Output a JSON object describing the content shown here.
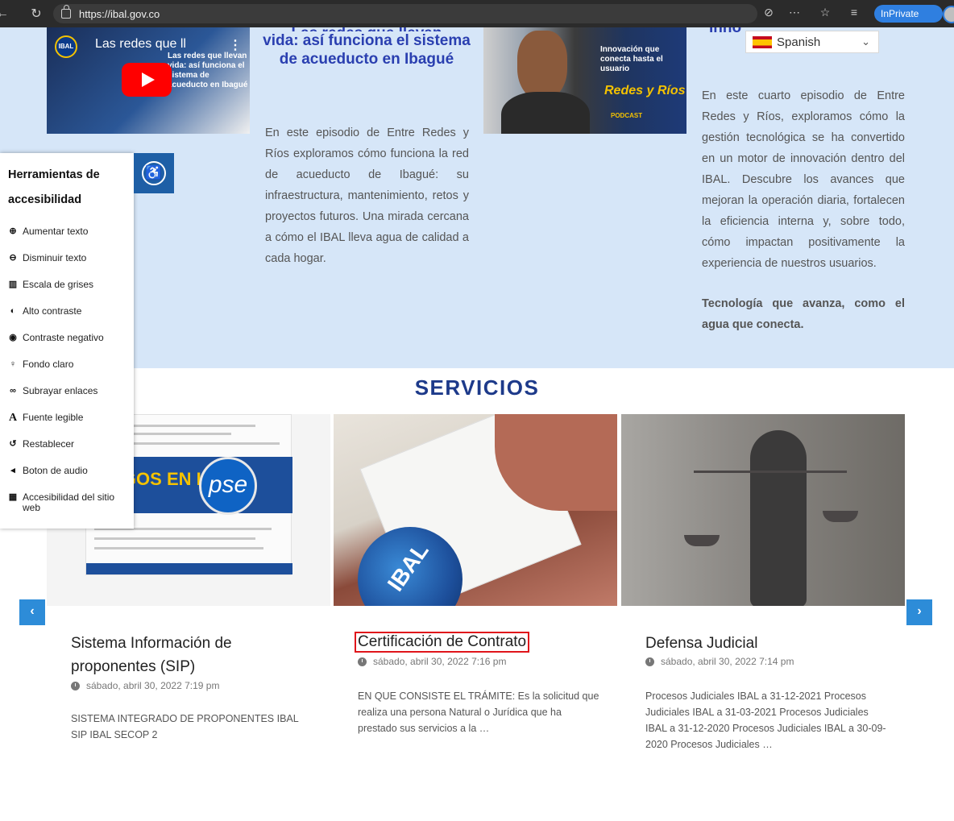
{
  "browser": {
    "url": "https://ibal.gov.co",
    "inprivate_label": "InPrivate",
    "icons": [
      "back-icon",
      "refresh-icon",
      "lock-icon",
      "tracking-icon",
      "more-icon",
      "favorites-icon",
      "collections-icon",
      "profile-icon"
    ]
  },
  "language": {
    "selected": "Spanish"
  },
  "episodes": {
    "video": {
      "title": "Las redes que ll",
      "thumb_caption": "Las redes que llevan vida: así funciona el sistema de acueducto en Ibagué"
    },
    "episode2": {
      "title_cut": "Las redes que llevan",
      "title": "vida: así funciona el sistema de acueducto en Ibagué",
      "body": "En este episodio de Entre Redes y Ríos exploramos cómo funciona la red de acueducto de Ibagué: su infraestructura, mantenimiento, retos y proyectos futuros. Una mirada cercana a cómo el IBAL lleva agua de calidad a cada hogar."
    },
    "episode3_thumb": {
      "caption": "Innovación que conecta hasta el usuario",
      "brand": "Redes y Ríos",
      "sub": "PODCAST"
    },
    "episode4": {
      "title": "Inno",
      "body": "En este cuarto episodio de Entre Redes y Ríos, exploramos cómo la gestión tecnológica se ha convertido en un motor de innovación dentro del IBAL. Descubre los avances que mejoran la operación diaria, fortalecen la eficiencia interna y, sobre todo, cómo impactan positivamente la experiencia de nuestros usuarios.",
      "strong": "Tecnología que avanza, como el agua que conecta."
    }
  },
  "accessibility": {
    "title": "Herramientas de accesibilidad",
    "items": [
      {
        "icon": "zoom-in-icon",
        "glyph": "⊕",
        "label": "Aumentar texto"
      },
      {
        "icon": "zoom-out-icon",
        "glyph": "⊖",
        "label": "Disminuir texto"
      },
      {
        "icon": "grayscale-icon",
        "glyph": "▥",
        "label": "Escala de grises"
      },
      {
        "icon": "contrast-icon",
        "glyph": "◐",
        "label": "Alto contraste"
      },
      {
        "icon": "eye-icon",
        "glyph": "◉",
        "label": "Contraste negativo"
      },
      {
        "icon": "bulb-icon",
        "glyph": "♀",
        "label": "Fondo claro"
      },
      {
        "icon": "link-icon",
        "glyph": "∞",
        "label": "Subrayar enlaces"
      },
      {
        "icon": "font-icon",
        "glyph": "A",
        "label": "Fuente legible"
      },
      {
        "icon": "reset-icon",
        "glyph": "↺",
        "label": "Restablecer"
      },
      {
        "icon": "audio-icon",
        "glyph": "◂",
        "label": "Boton de audio"
      },
      {
        "icon": "keyboard-icon",
        "glyph": "▦",
        "label": "Accesibilidad del sitio web"
      }
    ]
  },
  "services": {
    "heading": "SERVICIOS",
    "cards": [
      {
        "title": "Sistema Información de proponentes (SIP)",
        "date": "sábado, abril 30, 2022 7:19 pm",
        "text": "SISTEMA INTEGRADO DE PROPONENTES IBAL SIP IBAL SECOP 2",
        "image_text": "PAGOS EN LÍNEA",
        "image_logo": "pse"
      },
      {
        "title": "Certificación de Contrato",
        "date": "sábado, abril 30, 2022 7:16 pm",
        "text": "EN QUE CONSISTE EL TRÁMITE: Es la solicitud que realiza una persona Natural o Jurídica que ha prestado sus servicios a la …",
        "image_text": "IBAL"
      },
      {
        "title": "Defensa Judicial",
        "date": "sábado, abril 30, 2022 7:14 pm",
        "text": "Procesos Judiciales IBAL a 31-12-2021 Procesos Judiciales IBAL a 31-03-2021 Procesos Judiciales IBAL a 31-12-2020 Procesos Judiciales IBAL a 30-09-2020 Procesos Judiciales …"
      }
    ],
    "prev_label": "‹",
    "next_label": "›"
  },
  "colors": {
    "band": "#d6e6f8",
    "heading": "#1d3a8a",
    "episode_title": "#2a3fb0",
    "arrow": "#2d8cd8",
    "highlight": "#e0151b",
    "acc_toggle": "#1e5fa6"
  }
}
